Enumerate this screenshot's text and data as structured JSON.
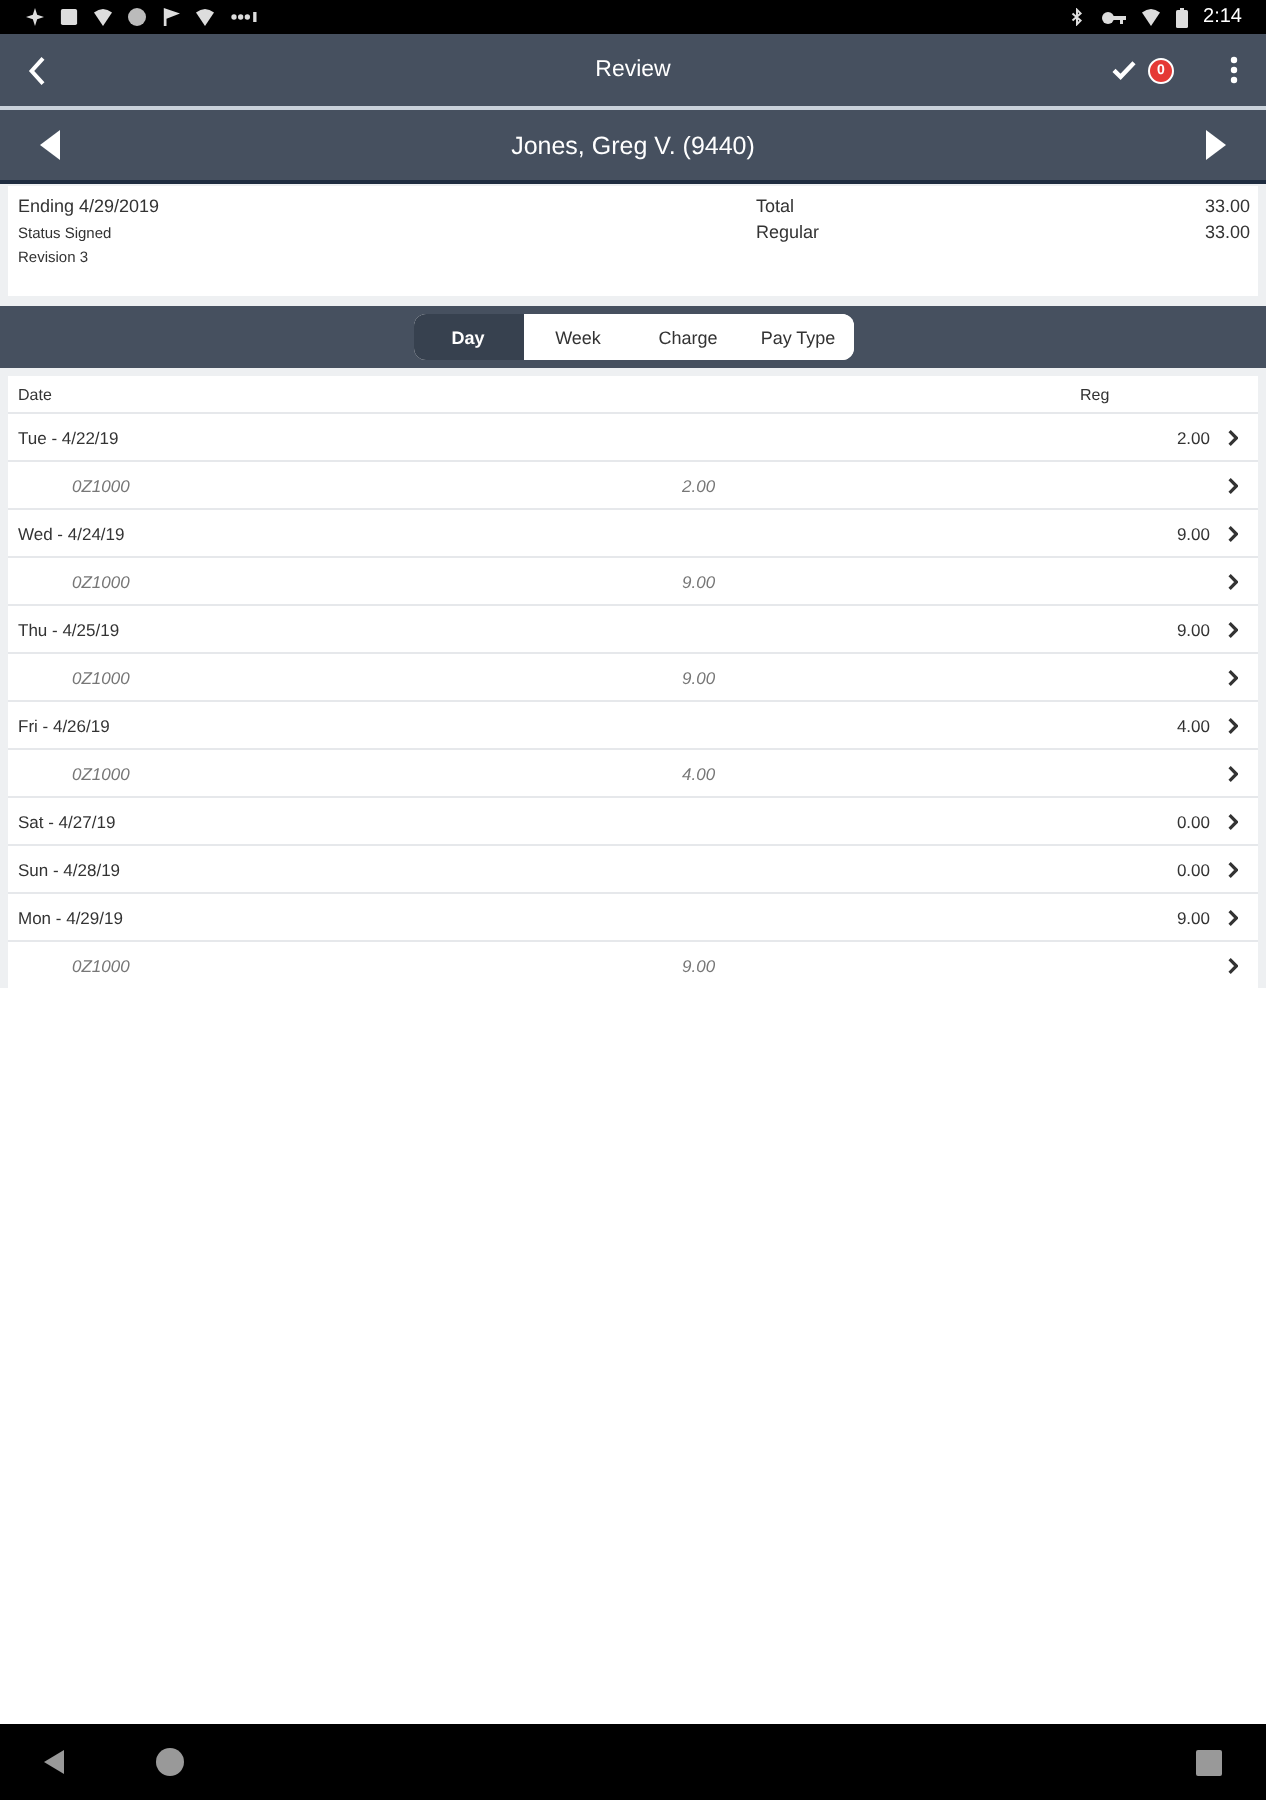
{
  "status_bar": {
    "time": "2:14"
  },
  "app_bar": {
    "title": "Review",
    "badge": "0"
  },
  "employee_bar": {
    "name": "Jones, Greg V. (9440)"
  },
  "summary": {
    "period": "Ending 4/29/2019",
    "status": "Status Signed",
    "revision": "Revision 3",
    "totals": [
      {
        "label": "Total",
        "value": "33.00"
      },
      {
        "label": "Regular",
        "value": "33.00"
      }
    ]
  },
  "tabs": [
    {
      "label": "Day",
      "selected": true
    },
    {
      "label": "Week",
      "selected": false
    },
    {
      "label": "Charge",
      "selected": false
    },
    {
      "label": "Pay Type",
      "selected": false
    }
  ],
  "table": {
    "columns": [
      "Date",
      "Reg"
    ],
    "rows": [
      {
        "date": "Tue - 4/22/19",
        "reg": "2.00",
        "children": [
          {
            "code": "0Z1000",
            "hours": "2.00"
          }
        ]
      },
      {
        "date": "Wed - 4/24/19",
        "reg": "9.00",
        "children": [
          {
            "code": "0Z1000",
            "hours": "9.00"
          }
        ]
      },
      {
        "date": "Thu - 4/25/19",
        "reg": "9.00",
        "children": [
          {
            "code": "0Z1000",
            "hours": "9.00"
          }
        ]
      },
      {
        "date": "Fri - 4/26/19",
        "reg": "4.00",
        "children": [
          {
            "code": "0Z1000",
            "hours": "4.00"
          }
        ]
      },
      {
        "date": "Sat - 4/27/19",
        "reg": "0.00"
      },
      {
        "date": "Sun - 4/28/19",
        "reg": "0.00"
      },
      {
        "date": "Mon - 4/29/19",
        "reg": "9.00",
        "children": [
          {
            "code": "0Z1000",
            "hours": "9.00"
          }
        ]
      }
    ]
  }
}
